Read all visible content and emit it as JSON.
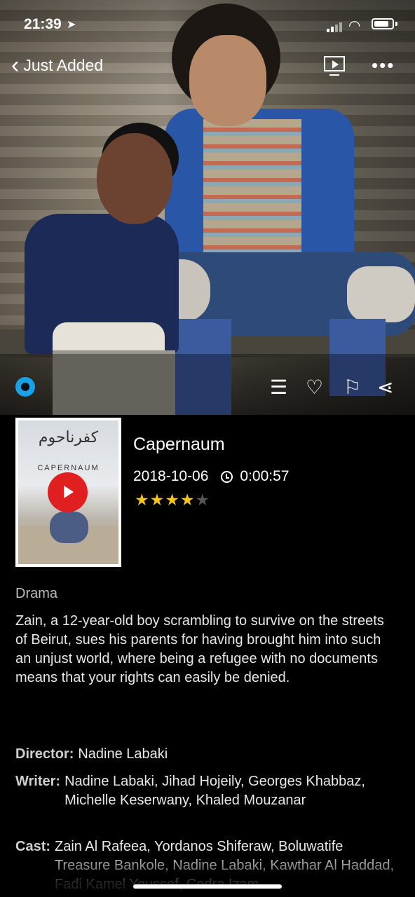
{
  "status_bar": {
    "time": "21:39",
    "location_icon": "location-arrow-icon"
  },
  "nav": {
    "back_label": "Just Added",
    "cast_icon": "airplay-icon",
    "more_icon": "more-dots-icon"
  },
  "actions": {
    "watched_indicator_color": "#1aa0e6",
    "icons": [
      "list-icon",
      "heart-icon",
      "bookmark-icon",
      "share-icon"
    ]
  },
  "poster": {
    "arabic_title": "كفرناحوم",
    "caption": "CAPERNAUM"
  },
  "movie": {
    "title": "Capernaum",
    "date": "2018-10-06",
    "duration": "0:00:57",
    "rating": 4,
    "rating_max": 5,
    "genre": "Drama",
    "summary": "Zain, a 12-year-old boy scrambling to survive on the streets of Beirut, sues his parents for having brought him into such an unjust world, where being a refugee with no documents means that your rights can easily be denied."
  },
  "credits": {
    "director_label": "Director:",
    "director": "Nadine Labaki",
    "writer_label": "Writer:",
    "writer": "Nadine Labaki, Jihad Hojeily, Georges Khabbaz, Michelle Keserwany, Khaled Mouzanar",
    "cast_label": "Cast:",
    "cast": "Zain Al Rafeea, Yordanos Shiferaw, Boluwatife Treasure Bankole, Nadine Labaki, Kawthar Al Haddad, Fadi Kamel Youssef, Cedra Izam"
  },
  "colors": {
    "accent": "#1aa0e6",
    "star": "#f5c518",
    "play": "#e02020"
  }
}
